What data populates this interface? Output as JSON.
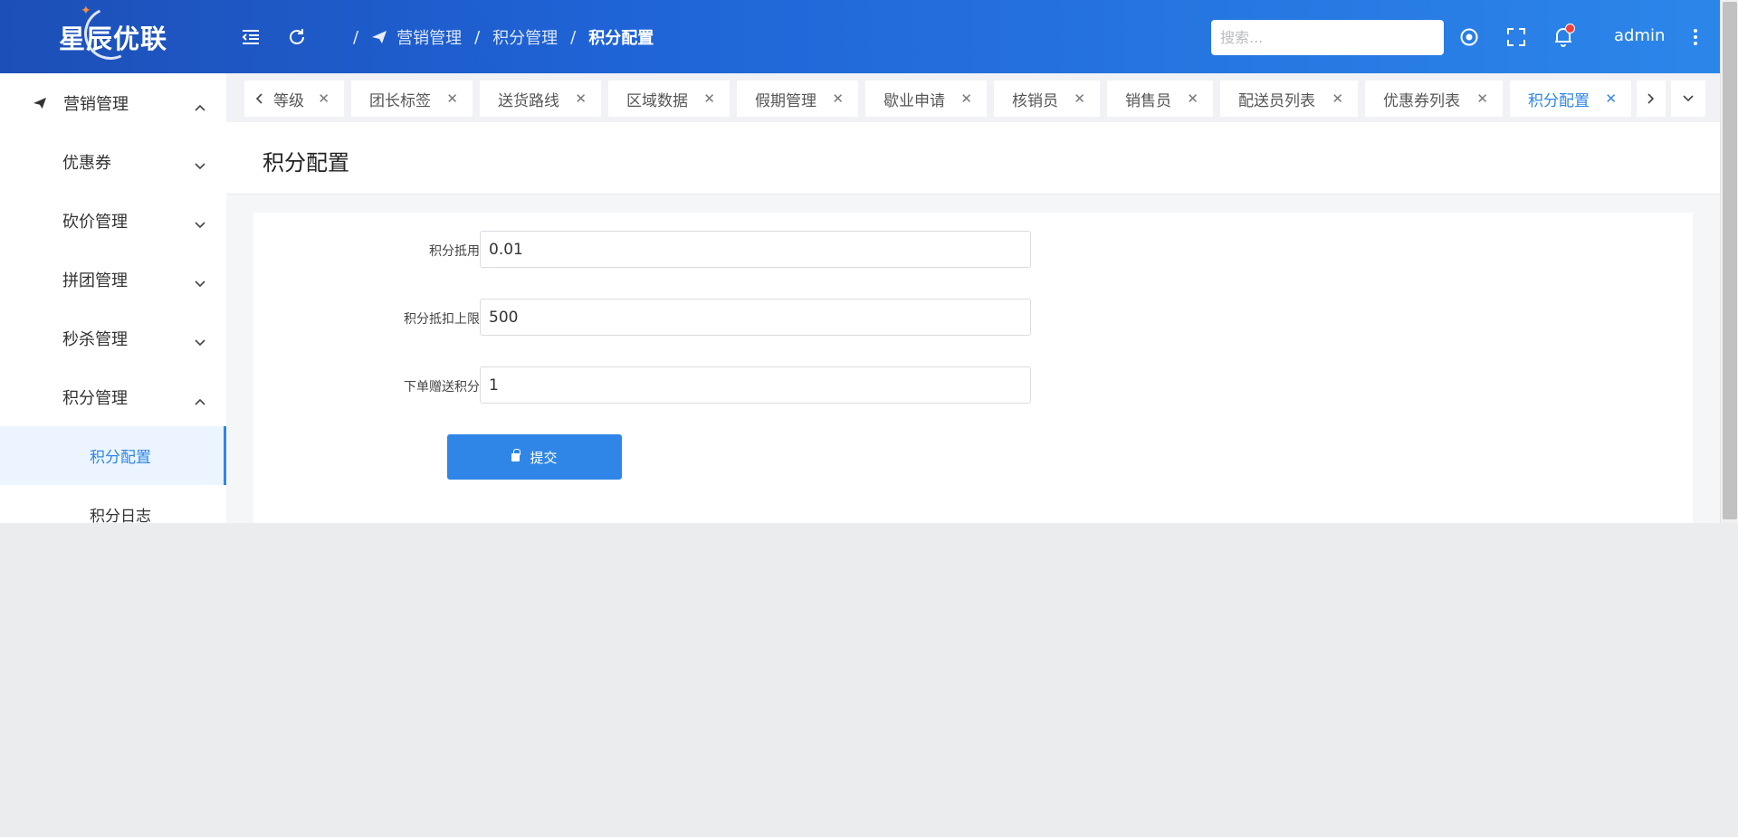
{
  "header": {
    "logo_text": "星辰优联",
    "breadcrumb": [
      "营销管理",
      "积分管理",
      "积分配置"
    ],
    "search_placeholder": "搜索...",
    "user": "admin"
  },
  "sidebar": {
    "items": [
      {
        "label": "营销管理",
        "icon": "paper-plane-icon",
        "expanded": true
      },
      {
        "label": "优惠券"
      },
      {
        "label": "砍价管理"
      },
      {
        "label": "拼团管理"
      },
      {
        "label": "秒杀管理"
      },
      {
        "label": "积分管理",
        "expanded": true
      },
      {
        "label": "积分配置",
        "active": true
      },
      {
        "label": "积分日志"
      }
    ]
  },
  "tabs": [
    {
      "label": "等级"
    },
    {
      "label": "团长标签"
    },
    {
      "label": "送货路线"
    },
    {
      "label": "区域数据"
    },
    {
      "label": "假期管理"
    },
    {
      "label": "歇业申请"
    },
    {
      "label": "核销员"
    },
    {
      "label": "销售员"
    },
    {
      "label": "配送员列表"
    },
    {
      "label": "优惠券列表"
    },
    {
      "label": "积分配置",
      "active": true
    }
  ],
  "page": {
    "title": "积分配置",
    "form": [
      {
        "label": "积分抵用",
        "value": "0.01"
      },
      {
        "label": "积分抵扣上限",
        "value": "500"
      },
      {
        "label": "下单赠送积分",
        "value": "1"
      }
    ],
    "submit_label": "提交"
  },
  "colors": {
    "accent": "#2f86e6",
    "header_start": "#1d4fb7",
    "header_end": "#2c86ea",
    "notification_dot": "#f0413f"
  }
}
